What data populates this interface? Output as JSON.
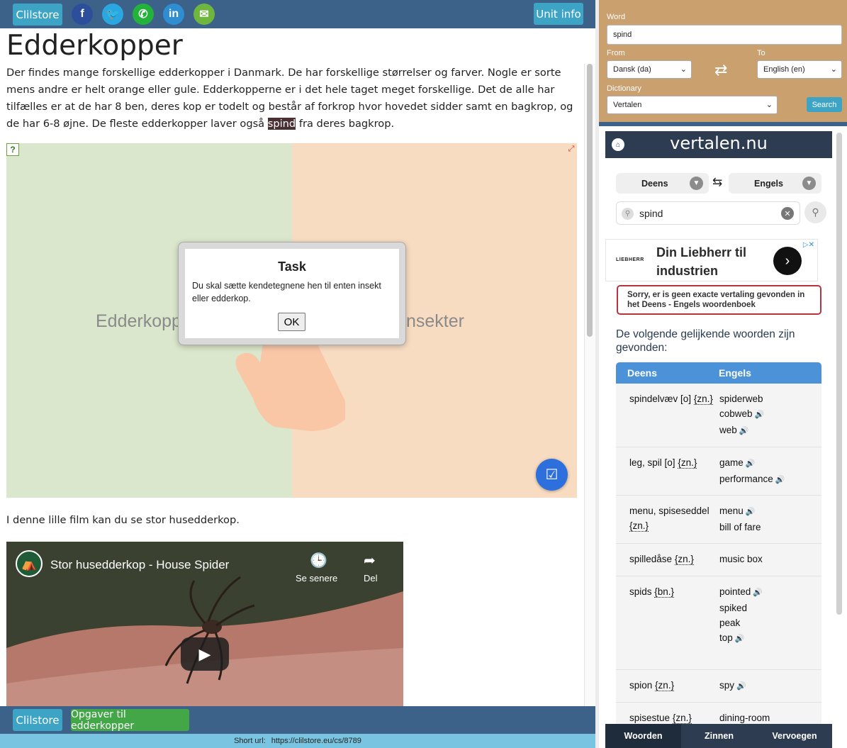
{
  "topbar": {
    "clilstore_label": "Clilstore",
    "unit_info_label": "Unit info",
    "social": {
      "facebook": "f",
      "twitter": "🐦",
      "whatsapp": "✆",
      "linkedin": "in",
      "email": "✉"
    }
  },
  "article": {
    "title": "Edderkopper",
    "intro_before": "Der findes mange forskellige edderkopper i Danmark. De har forskellige størrelser og farver. Nogle er sorte mens andre er helt orange eller gule. Edderkopperne er i det hele taget meget forskellige. Det de alle har tilfælles er at de har 8 ben, deres kop er todelt og består af forkrop hvor hovedet sidder samt en bagkrop, og de har 6-8 øjne. De fleste edderkopper laver også ",
    "intro_highlight": "spind",
    "intro_after": " fra deres bagkrop.",
    "video_caption": "I denne lille film kan du se stor husedderkop."
  },
  "activity": {
    "category_left": "Edderkopper",
    "category_right": "Insekter",
    "dialog": {
      "title": "Task",
      "text": "Du skal sætte kendetegnene hen til enten insekt eller edderkop.",
      "ok_label": "OK"
    }
  },
  "video": {
    "title": "Stor husedderkop - House Spider",
    "watch_later_label": "Se senere",
    "share_label": "Del"
  },
  "bottombar": {
    "clilstore_label": "Clilstore",
    "tasks_label": "Opgaver til edderkopper",
    "short_url_label": "Short url:",
    "short_url_value": "https://clilstore.eu/cs/8789"
  },
  "lookup": {
    "word_label": "Word",
    "word_value": "spind",
    "from_label": "From",
    "to_label": "To",
    "from_value": "Dansk (da)",
    "to_value": "English (en)",
    "dictionary_label": "Dictionary",
    "dictionary_value": "Vertalen",
    "search_label": "Search"
  },
  "dictionary": {
    "logo": "vertalen.nu",
    "lang_from": "Deens",
    "lang_to": "Engels",
    "search_value": "spind",
    "ad_text": "Din Liebherr til industrien",
    "ad_logo": "LIEBHERR",
    "no_result": "Sorry, er is geen exacte vertaling gevonden in het Deens - Engels woordenboek",
    "similar_heading": "De volgende gelijkende woorden zijn gevonden:",
    "col_source": "Deens",
    "col_target": "Engels",
    "rows": [
      {
        "source": "spindelvæv [o]",
        "tag": "{zn.}",
        "targets": [
          {
            "word": "spiderweb",
            "audio": false
          },
          {
            "word": "cobweb",
            "audio": true
          },
          {
            "word": "web",
            "audio": true
          }
        ]
      },
      {
        "source": "leg, spil [o]",
        "tag": "{zn.}",
        "targets": [
          {
            "word": "game",
            "audio": true
          },
          {
            "word": "performance",
            "audio": true
          }
        ]
      },
      {
        "source": "menu, spiseseddel",
        "tag": "{zn.}",
        "targets": [
          {
            "word": "menu",
            "audio": true
          },
          {
            "word": "bill of fare",
            "audio": false
          }
        ]
      },
      {
        "source": "spilledåse",
        "tag": "{zn.}",
        "targets": [
          {
            "word": "music box",
            "audio": false
          }
        ]
      },
      {
        "source": "spids",
        "tag": "{bn.}",
        "targets": [
          {
            "word": "pointed",
            "audio": true
          },
          {
            "word": "spiked",
            "audio": false
          },
          {
            "word": "peak",
            "audio": false
          },
          {
            "word": "top",
            "audio": true
          }
        ]
      },
      {
        "source": "spion",
        "tag": "{zn.}",
        "targets": [
          {
            "word": "spy",
            "audio": true
          }
        ]
      },
      {
        "source": "spisestue",
        "tag": "{zn.}",
        "targets": [
          {
            "word": "dining-room",
            "audio": false
          }
        ]
      }
    ],
    "tabs": {
      "words": "Woorden",
      "sentences": "Zinnen",
      "conjugate": "Vervoegen"
    }
  },
  "colors": {
    "header_blue": "#3d6289",
    "button_blue": "#3da4c6",
    "button_green": "#43a647",
    "panel_tan": "#c9a06e",
    "table_header": "#4b92d8"
  }
}
